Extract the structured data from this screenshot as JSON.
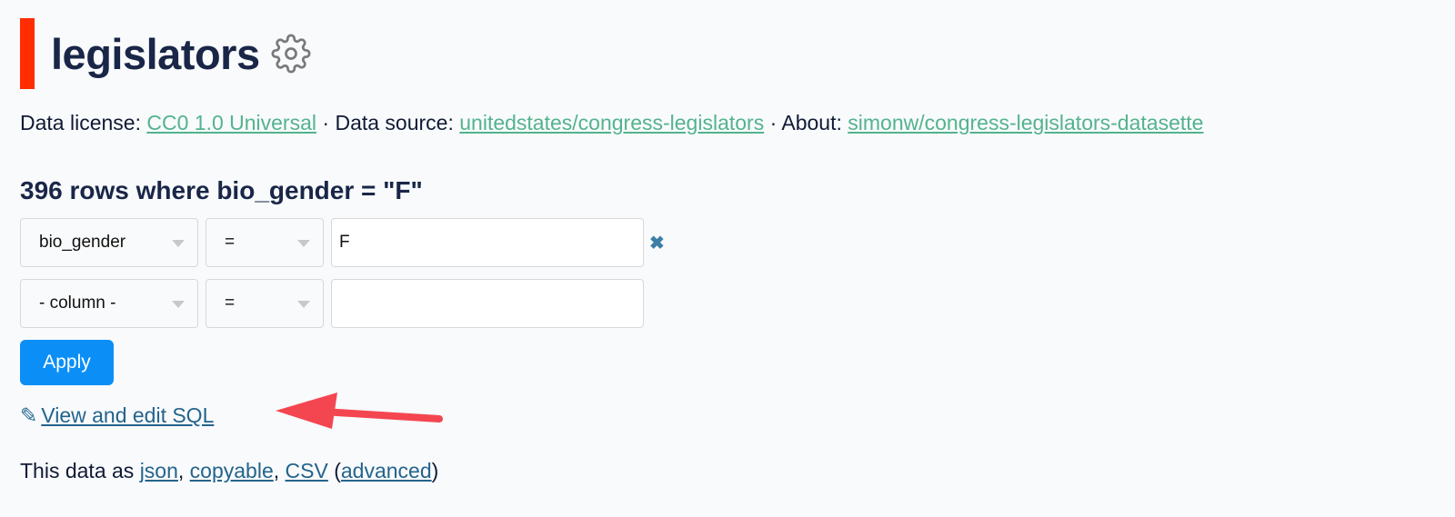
{
  "header": {
    "title": "legislators",
    "accent_color": "#ff2d00",
    "settings_icon": "gear-icon"
  },
  "metadata": {
    "license_label": "Data license:",
    "license_link": "CC0 1.0 Universal",
    "sep1": " · ",
    "source_label": "Data source:",
    "source_link": "unitedstates/congress-legislators",
    "sep2": " · ",
    "about_label": "About:",
    "about_link": "simonw/congress-legislators-datasette",
    "link_color": "#54b38d"
  },
  "results": {
    "summary": "396 rows where bio_gender = \"F\""
  },
  "filters": [
    {
      "column": "bio_gender",
      "operator": "=",
      "value": "F",
      "removable": true,
      "remove_icon": "close-icon"
    },
    {
      "column": "- column -",
      "operator": "=",
      "value": "",
      "removable": false
    }
  ],
  "apply_button": {
    "label": "Apply",
    "color": "#0b8ff7"
  },
  "sql_link": {
    "icon": "pencil-icon",
    "icon_glyph": "✎",
    "label": "View and edit SQL"
  },
  "export": {
    "prefix": "This data as ",
    "json": "json",
    "comma1": ", ",
    "copyable": "copyable",
    "comma2": ", ",
    "csv": "CSV",
    "open_paren": " (",
    "advanced": "advanced",
    "close_paren": ")"
  },
  "annotation": {
    "type": "arrow",
    "color": "#f44650",
    "points_to": "View and edit SQL"
  }
}
